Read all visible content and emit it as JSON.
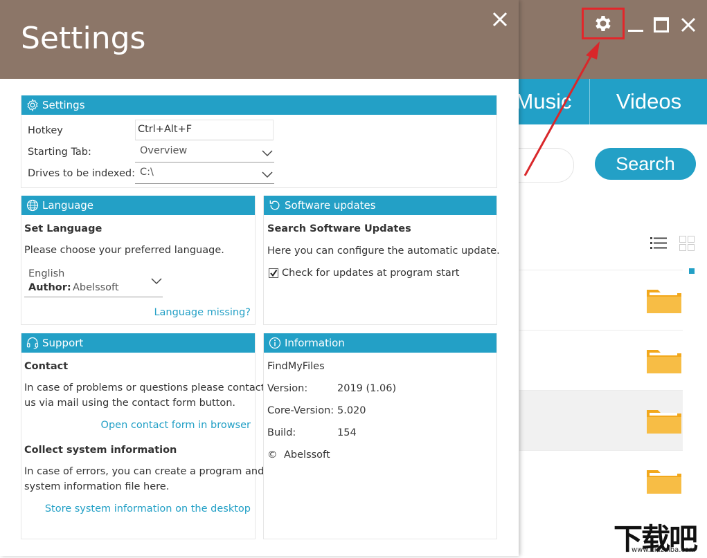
{
  "app": {
    "tabs": [
      "Music",
      "Videos"
    ],
    "search_label": "Search",
    "colors": {
      "header": "#8c7668",
      "accent": "#23a0c6",
      "highlight": "#e3262a"
    },
    "icons": [
      "gear-icon",
      "minimize-icon",
      "maximize-icon",
      "close-icon",
      "list-view-icon",
      "grid-view-icon",
      "folder-icon"
    ],
    "watermark": {
      "title": "下载吧",
      "url": "www.xiazaiba.com"
    }
  },
  "dialog": {
    "title": "Settings",
    "settings": {
      "header": "Settings",
      "hotkey_label": "Hotkey",
      "hotkey_value": "Ctrl+Alt+F",
      "starting_tab_label": "Starting Tab:",
      "starting_tab_value": "Overview",
      "drives_label": "Drives to be indexed:",
      "drives_value": "C:\\"
    },
    "language": {
      "header": "Language",
      "title": "Set Language",
      "desc": "Please choose your preferred language.",
      "selected": "English",
      "author_label": "Author:",
      "author_value": "Abelssoft",
      "missing_link": "Language missing?"
    },
    "updates": {
      "header": "Software updates",
      "title": "Search Software Updates",
      "desc": "Here you can configure the automatic update.",
      "checkbox_label": "Check for updates at program start",
      "checked": true
    },
    "support": {
      "header": "Support",
      "contact_title": "Contact",
      "contact_desc_1": "In case of problems or questions please contact",
      "contact_desc_2": "us via mail using the contact form button.",
      "contact_link": "Open contact form in browser",
      "collect_title": "Collect system information",
      "collect_desc_1": "In case of errors, you can create a program and",
      "collect_desc_2": "system information file here.",
      "collect_link": "Store system information on the desktop"
    },
    "information": {
      "header": "Information",
      "product": "FindMyFiles",
      "version_label": "Version:",
      "version_value": "2019 (1.06)",
      "core_label": "Core-Version:",
      "core_value": "5.020",
      "build_label": "Build:",
      "build_value": "154",
      "copyright_symbol": "©",
      "copyright_owner": "Abelssoft"
    }
  }
}
